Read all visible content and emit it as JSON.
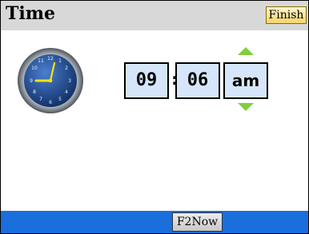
{
  "header": {
    "title": "Time",
    "finish_label": "Finish"
  },
  "time": {
    "hours": "09",
    "separator": ":",
    "minutes": "06",
    "period": "am"
  },
  "footer": {
    "f2now_label": "F2Now"
  },
  "colors": {
    "header_bg": "#d8d8d8",
    "field_bg": "#d6e6fa",
    "arrow": "#7fd03a",
    "footer_bg": "#1a6fdc",
    "finish_btn": "#f7d56a",
    "clock_face": "#1e4f93",
    "clock_hands": "#ffe400"
  },
  "icons": {
    "clock": "analog-clock-icon",
    "up": "arrow-up-icon",
    "down": "arrow-down-icon"
  }
}
